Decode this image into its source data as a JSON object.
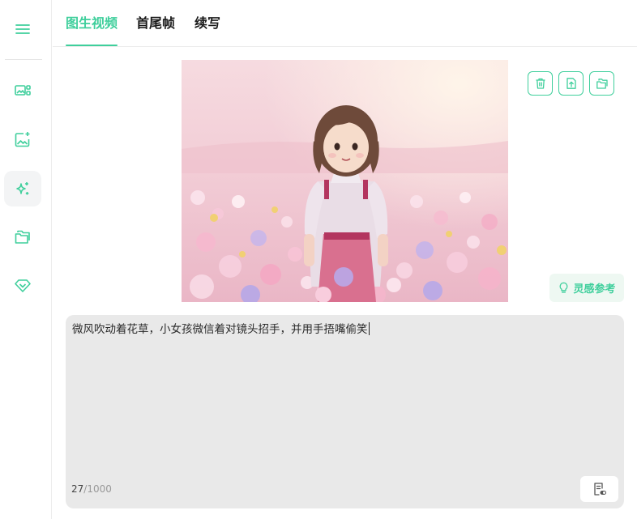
{
  "sidebar": {
    "items": [
      {
        "icon": "menu-icon"
      },
      {
        "icon": "image-grid-icon"
      },
      {
        "icon": "image-sparkle-icon"
      },
      {
        "icon": "sparkles-icon",
        "active": true
      },
      {
        "icon": "folder-icon"
      },
      {
        "icon": "diamond-icon"
      }
    ]
  },
  "header": {
    "tabs": [
      {
        "label": "图生视频",
        "active": true
      },
      {
        "label": "首尾帧",
        "active": false
      },
      {
        "label": "续写",
        "active": false
      }
    ]
  },
  "preview": {
    "actions": [
      "trash-icon",
      "upload-icon",
      "folder-icon"
    ]
  },
  "inspire": {
    "label": "灵感参考"
  },
  "prompt": {
    "text": "微风吹动着花草，小女孩微信着对镜头招手，并用手捂嘴偷笑",
    "count": "27",
    "max": "/1000"
  },
  "colors": {
    "accent": "#3fcf9c",
    "prompt_bg": "#e9e9e9"
  }
}
